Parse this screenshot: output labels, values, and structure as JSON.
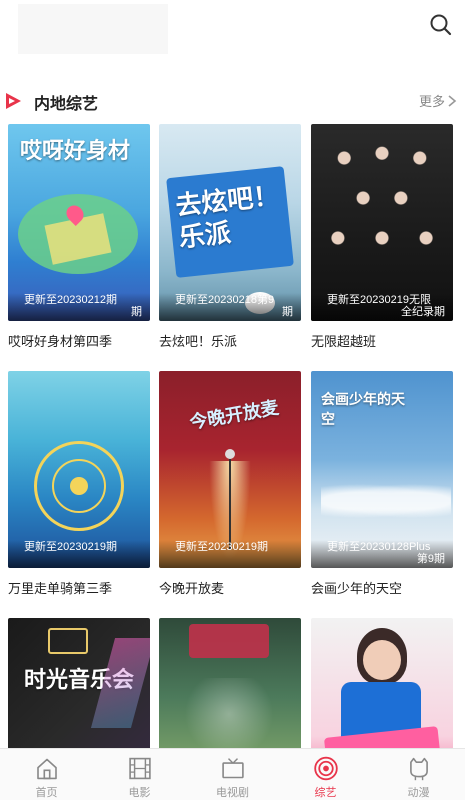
{
  "icons": {
    "search": "search-icon",
    "section": "play-triangle-icon",
    "more": "chevron-right-icon"
  },
  "colors": {
    "accent": "#e8344a",
    "section_icon": "#e8344a",
    "muted": "#999999"
  },
  "section": {
    "title": "内地综艺",
    "more_label": "更多"
  },
  "cards": [
    {
      "title": "哎呀好身材第四季",
      "poster_text": "哎呀好身材",
      "update": "更新至20230212期",
      "episode": "期"
    },
    {
      "title": "去炫吧！乐派",
      "poster_text": "去炫吧！乐派",
      "update": "更新至20230218第9",
      "episode": "期"
    },
    {
      "title": "无限超越班",
      "poster_text": "",
      "update": "更新至20230219无限",
      "episode": "全纪录期"
    },
    {
      "title": "万里走单骑第三季",
      "poster_text": "",
      "update": "更新至20230219期",
      "episode": ""
    },
    {
      "title": "今晚开放麦",
      "poster_text": "今晚开放麦",
      "update": "更新至20230219期",
      "episode": ""
    },
    {
      "title": "会画少年的天空",
      "poster_text": "会画少年的天空",
      "update": "更新至20230128Plus",
      "episode": "第9期"
    },
    {
      "title": "",
      "poster_text": "时光音乐会",
      "update": "",
      "episode": ""
    },
    {
      "title": "",
      "poster_text": "",
      "update": "",
      "episode": ""
    },
    {
      "title": "",
      "poster_text": "",
      "update": "",
      "episode": ""
    }
  ],
  "nav": [
    {
      "label": "首页",
      "icon": "home-icon",
      "active": false
    },
    {
      "label": "电影",
      "icon": "film-icon",
      "active": false
    },
    {
      "label": "电视剧",
      "icon": "tv-icon",
      "active": false
    },
    {
      "label": "综艺",
      "icon": "target-icon",
      "active": true
    },
    {
      "label": "动漫",
      "icon": "cat-icon",
      "active": false
    }
  ]
}
